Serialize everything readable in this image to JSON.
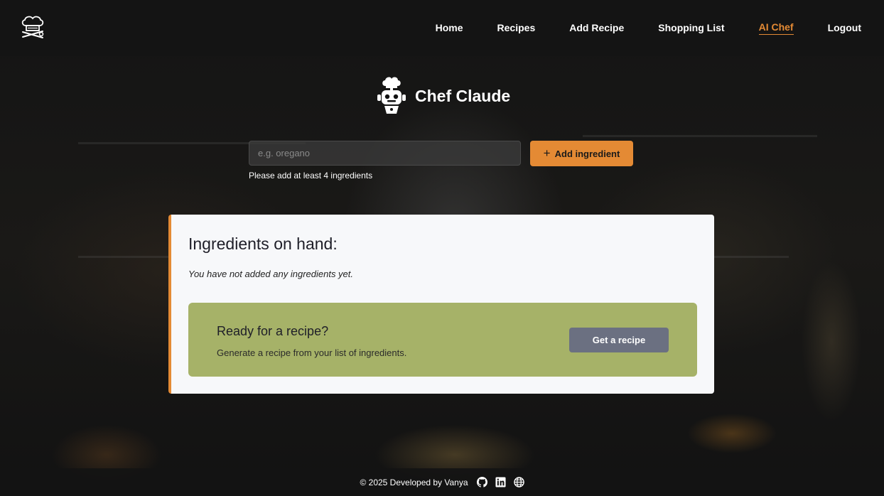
{
  "nav": {
    "logo": "chef-hat-logo",
    "links": [
      {
        "label": "Home"
      },
      {
        "label": "Recipes"
      },
      {
        "label": "Add Recipe"
      },
      {
        "label": "Shopping List"
      },
      {
        "label": "AI Chef",
        "active": true
      },
      {
        "label": "Logout"
      }
    ]
  },
  "header": {
    "icon": "robot-chef-icon",
    "title": "Chef Claude"
  },
  "ingredient_form": {
    "placeholder": "e.g. oregano",
    "value": "",
    "add_button_label": "Add ingredient",
    "hint": "Please add at least 4 ingredients"
  },
  "ingredients": {
    "title": "Ingredients on hand:",
    "empty_message": "You have not added any ingredients yet."
  },
  "recipe_cta": {
    "title": "Ready for a recipe?",
    "subtitle": "Generate a recipe from your list of ingredients.",
    "button_label": "Get a recipe"
  },
  "footer": {
    "text": "© 2025 Developed by Vanya",
    "icons": [
      "github-icon",
      "linkedin-icon",
      "globe-icon"
    ]
  },
  "colors": {
    "accent": "#e48a34",
    "cta_background": "#a6b268",
    "cta_button": "#6b7081"
  }
}
